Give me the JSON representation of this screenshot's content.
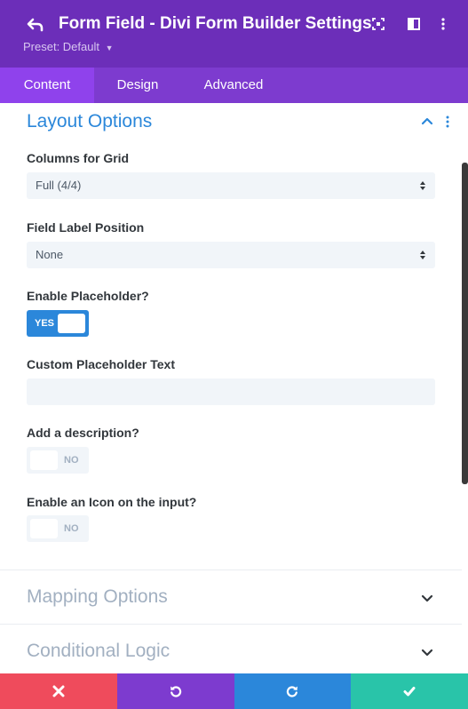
{
  "header": {
    "title": "Form Field - Divi Form Builder Settings",
    "preset_label": "Preset: Default",
    "icons": [
      "back-icon",
      "focus-mode-icon",
      "split-view-icon",
      "more-options-icon"
    ]
  },
  "tabs": [
    {
      "label": "Content",
      "active": true
    },
    {
      "label": "Design",
      "active": false
    },
    {
      "label": "Advanced",
      "active": false
    }
  ],
  "section": {
    "title": "Layout Options",
    "fields": {
      "columns": {
        "label": "Columns for Grid",
        "value": "Full (4/4)"
      },
      "label_position": {
        "label": "Field Label Position",
        "value": "None"
      },
      "placeholder": {
        "label": "Enable Placeholder?",
        "toggle": "YES"
      },
      "custom_placeholder": {
        "label": "Custom Placeholder Text",
        "value": ""
      },
      "description": {
        "label": "Add a description?",
        "toggle": "NO"
      },
      "icon": {
        "label": "Enable an Icon on the input?",
        "toggle": "NO"
      }
    }
  },
  "collapsed_sections": [
    {
      "title": "Mapping Options"
    },
    {
      "title": "Conditional Logic"
    }
  ],
  "footer": {
    "buttons": [
      {
        "name": "discard",
        "icon": "close-icon",
        "color": "#ef4b5c"
      },
      {
        "name": "undo",
        "icon": "undo-icon",
        "color": "#7d3bcf"
      },
      {
        "name": "redo",
        "icon": "redo-icon",
        "color": "#2b87da"
      },
      {
        "name": "save",
        "icon": "check-icon",
        "color": "#29c4a9"
      }
    ]
  },
  "colors": {
    "header": "#6c2eb9",
    "tab_bar": "#7d3bcf",
    "active_tab": "#8f42ec",
    "accent": "#2b87da"
  }
}
